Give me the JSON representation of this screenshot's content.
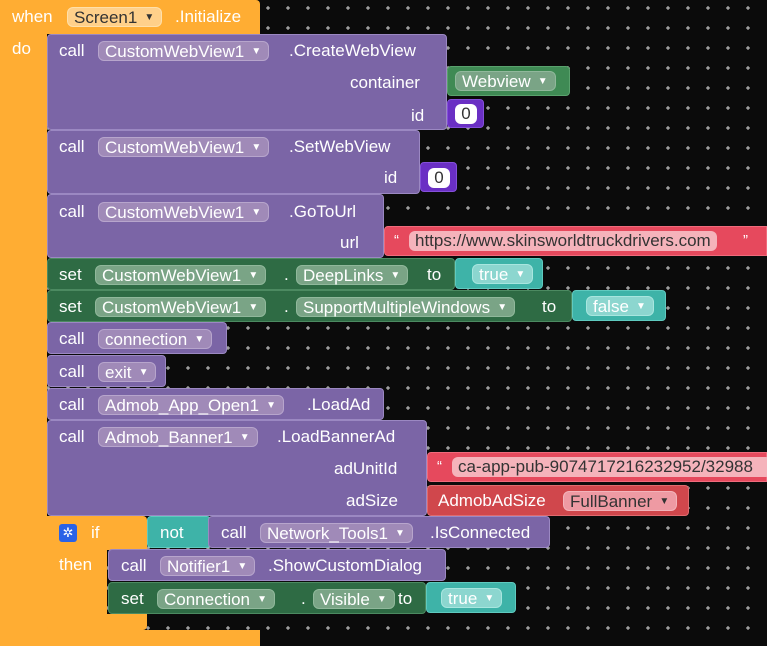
{
  "colors": {
    "control": "#ffad33",
    "call": "#7b65a6",
    "set": "#2e6b44",
    "text": "#e6495d",
    "logic": "#3eb3a8",
    "component": "#3f8a54",
    "number": "#6a2fc4",
    "admob_block": "#d0474c"
  },
  "event": {
    "when": "when",
    "component": "Screen1",
    "event": ".Initialize",
    "do": "do"
  },
  "blocks": {
    "b1": {
      "kw": "call",
      "component": "CustomWebView1",
      "method": ".CreateWebView",
      "arg1_label": "container",
      "arg1_value": "Webview",
      "arg2_label": "id",
      "arg2_value": "0"
    },
    "b2": {
      "kw": "call",
      "component": "CustomWebView1",
      "method": ".SetWebView",
      "arg1_label": "id",
      "arg1_value": "0"
    },
    "b3": {
      "kw": "call",
      "component": "CustomWebView1",
      "method": ".GoToUrl",
      "arg1_label": "url",
      "arg1_value": "https://www.skinsworldtruckdrivers.com",
      "quote_open": "“",
      "quote_close": "”"
    },
    "b4": {
      "kw": "set",
      "component": "CustomWebView1",
      "dot": ".",
      "property": "DeepLinks",
      "to": "to",
      "value": "true"
    },
    "b5": {
      "kw": "set",
      "component": "CustomWebView1",
      "dot": ".",
      "property": "SupportMultipleWindows",
      "to": "to",
      "value": "false"
    },
    "b6": {
      "kw": "call",
      "procedure": "connection"
    },
    "b7": {
      "kw": "call",
      "procedure": "exit"
    },
    "b8": {
      "kw": "call",
      "component": "Admob_App_Open1",
      "method": ".LoadAd"
    },
    "b9": {
      "kw": "call",
      "component": "Admob_Banner1",
      "method": ".LoadBannerAd",
      "arg1_label": "adUnitId",
      "arg1_value": "ca-app-pub-9074717216232952/32988",
      "arg2_label": "adSize",
      "arg2_prefix": "AdmobAdSize",
      "arg2_value": "FullBanner",
      "quote_open": "“"
    },
    "b10": {
      "if": "if",
      "then": "then",
      "not": "not",
      "kw": "call",
      "component": "Network_Tools1",
      "method": ".IsConnected"
    },
    "b11": {
      "kw": "call",
      "component": "Notifier1",
      "method": ".ShowCustomDialog"
    },
    "b12": {
      "kw": "set",
      "component": "Connection",
      "dot": ".",
      "property": "Visible",
      "to": "to",
      "value": "true"
    }
  }
}
